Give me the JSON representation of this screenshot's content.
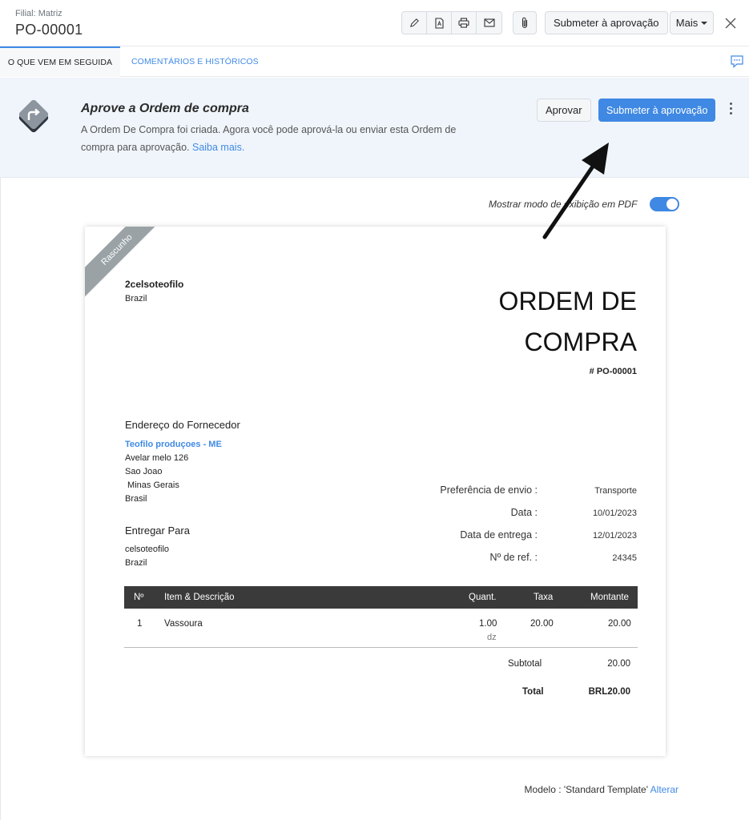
{
  "header": {
    "branch": "Filial: Matriz",
    "doc_id": "PO-00001",
    "tools": [
      "edit-icon",
      "pdf-icon",
      "print-icon",
      "email-icon"
    ],
    "attach_icon": "paperclip-icon",
    "submit_label": "Submeter à aprovação",
    "more_label": "Mais",
    "close_icon": "close-icon"
  },
  "tabs": {
    "next": "O QUE VEM EM SEGUIDA",
    "comments": "COMENTÁRIOS E HISTÓRICOS",
    "comment_icon": "comment-icon"
  },
  "banner": {
    "title": "Aprove a Ordem de compra",
    "description": "A Ordem De Compra foi criada. Agora você pode aprová-la ou enviar esta Ordem de compra para aprovação.",
    "learn_more": "Saiba mais.",
    "approve_label": "Aprovar",
    "submit_label": "Submeter à aprovação"
  },
  "pdf_toggle": {
    "label": "Mostrar modo de exibição em PDF",
    "enabled": true
  },
  "document": {
    "status_ribbon": "Rascunho",
    "company": "2celsoteofilo",
    "company_country": "Brazil",
    "title_line1": "ORDEM DE",
    "title_line2": "COMPRA",
    "number": "# PO-00001",
    "vendor_heading": "Endereço do Fornecedor",
    "vendor_name": "Teofilo produçoes - ME",
    "vendor_address": [
      "Avelar melo 126",
      "Sao Joao",
      " Minas Gerais",
      "Brasil"
    ],
    "deliver_heading": "Entregar Para",
    "deliver_address": [
      "celsoteofilo",
      "Brazil"
    ],
    "meta": [
      {
        "label": "Preferência de envio :",
        "value": "Transporte"
      },
      {
        "label": "Data :",
        "value": "10/01/2023"
      },
      {
        "label": "Data de entrega :",
        "value": "12/01/2023"
      },
      {
        "label": "Nº de ref. :",
        "value": "24345"
      }
    ],
    "table": {
      "headers": [
        "Nº",
        "Item & Descrição",
        "Quant.",
        "Taxa",
        "Montante"
      ],
      "rows": [
        {
          "num": "1",
          "item": "Vassoura",
          "qty": "1.00",
          "unit": "dz",
          "rate": "20.00",
          "amount": "20.00"
        }
      ]
    },
    "subtotal_label": "Subtotal",
    "subtotal_value": "20.00",
    "total_label": "Total",
    "total_value": "BRL20.00"
  },
  "footer": {
    "template_text": "Modelo : 'Standard Template'",
    "change_link": "Alterar"
  },
  "colors": {
    "accent": "#3f88e3",
    "ribbon": "#9aa2a6",
    "table_header": "#3a3a3a",
    "banner_bg": "#f0f5fb"
  }
}
